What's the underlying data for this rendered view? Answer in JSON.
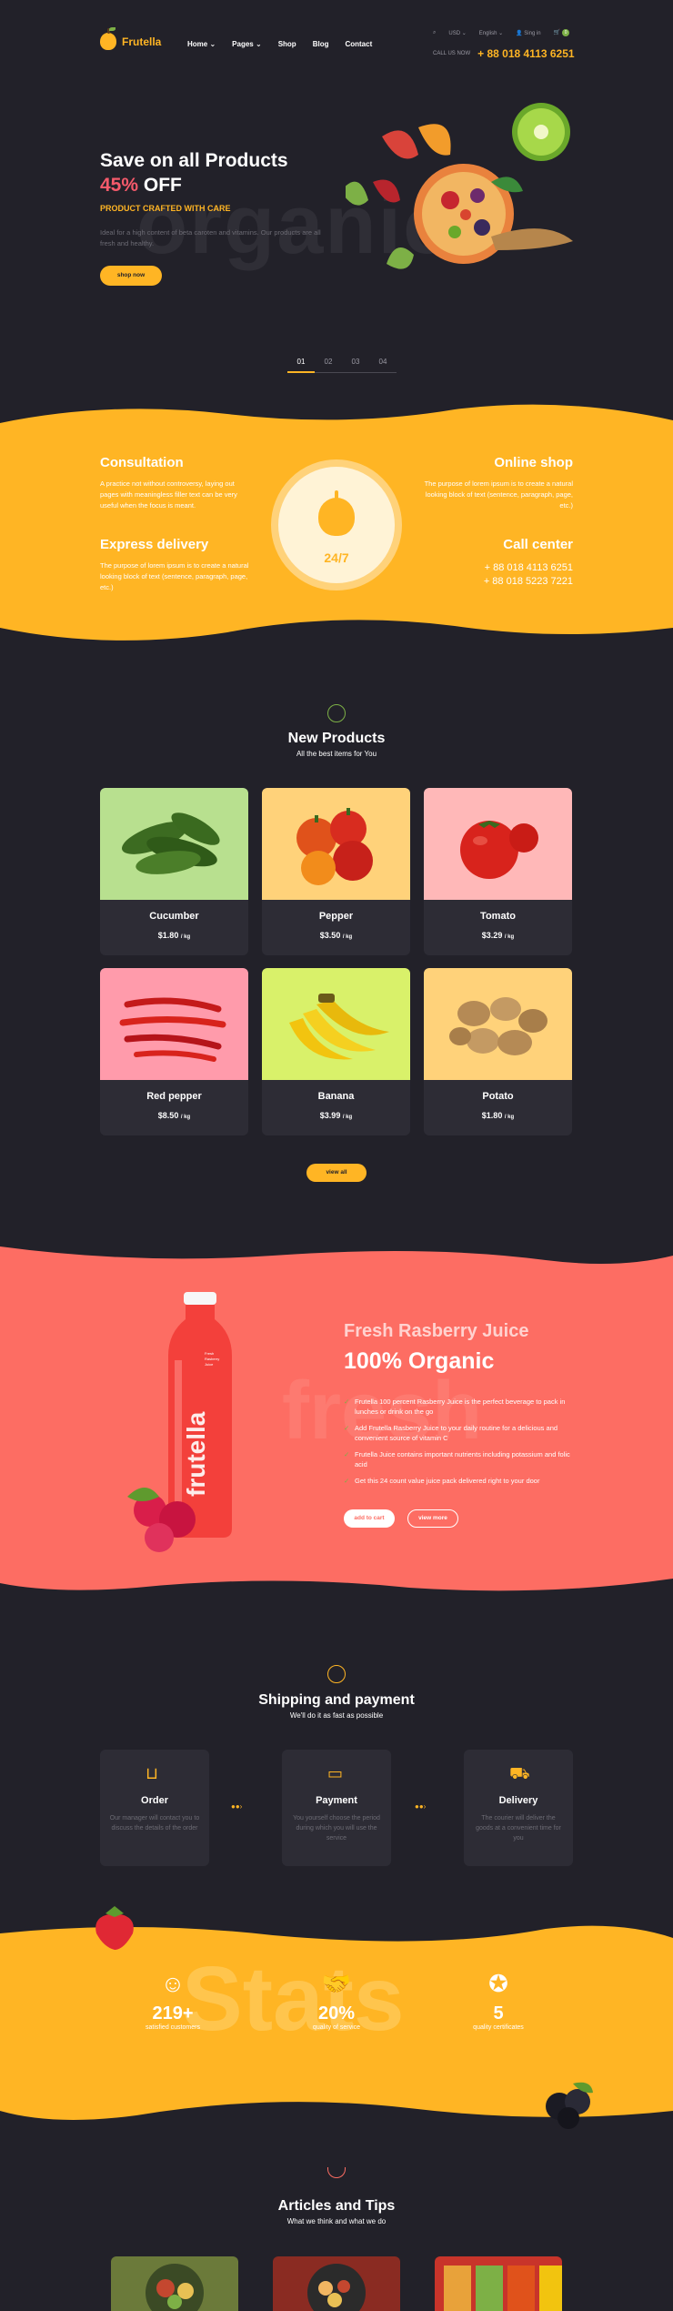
{
  "header": {
    "logo": "Frutella",
    "nav": [
      "Home",
      "Pages",
      "Shop",
      "Blog",
      "Contact"
    ],
    "currency": "USD",
    "language": "English",
    "signin": "Sing in",
    "cart_count": "0",
    "callus_label": "CALL US NOW",
    "phone": "+ 88 018 4113 6251"
  },
  "hero": {
    "title_line1": "Save on all Products",
    "title_pct": "45%",
    "title_off": "OFF",
    "subtitle": "PRODUCT CRAFTED WITH CARE",
    "description": "Ideal for a high content of beta caroten and vitamins. Our products are all fresh and healthy.",
    "bg_word": "organic",
    "button": "shop now",
    "slides": [
      "01",
      "02",
      "03",
      "04"
    ]
  },
  "features": {
    "consultation_title": "Consultation",
    "consultation_text": "A practice not without controversy, laying out pages with meaningless filler text can be very useful when the focus is meant.",
    "express_title": "Express delivery",
    "express_text": "The purpose of lorem ipsum is to create a natural looking block of text (sentence, paragraph, page, etc.)",
    "center_label": "24/7",
    "online_title": "Online shop",
    "online_text": "The purpose of lorem ipsum is to create a natural looking block of text (sentence, paragraph, page, etc.)",
    "call_title": "Call center",
    "call_phone1": "+ 88 018 4113 6251",
    "call_phone2": "+ 88 018 5223 7221"
  },
  "products": {
    "title": "New Products",
    "subtitle": "All the best items for You",
    "items": [
      {
        "name": "Cucumber",
        "price": "$1.80",
        "unit": "/ kg",
        "bg": "#b8e08f"
      },
      {
        "name": "Pepper",
        "price": "$3.50",
        "unit": "/ kg",
        "bg": "#ffd27a"
      },
      {
        "name": "Tomato",
        "price": "$3.29",
        "unit": "/ kg",
        "bg": "#ffb8b8"
      },
      {
        "name": "Red pepper",
        "price": "$8.50",
        "unit": "/ kg",
        "bg": "#ff9bab"
      },
      {
        "name": "Banana",
        "price": "$3.99",
        "unit": "/ kg",
        "bg": "#d9f16a"
      },
      {
        "name": "Potato",
        "price": "$1.80",
        "unit": "/ kg",
        "bg": "#ffd27a"
      }
    ],
    "button": "view all"
  },
  "juice": {
    "title": "Fresh Rasberry Juice",
    "headline": "100% Organic",
    "bg_word": "fresh",
    "bottle_label": "frutella",
    "bottle_small": "Fresh Rasberry Juice",
    "points": [
      "Frutella 100 percent Rasberry Juice is the perfect beverage to pack in lunches or drink on the go",
      "Add Frutella Rasberry Juice to your daily routine for a delicious and convenient source of vitamin C",
      "Frutella Juice contains important nutrients including potassium and folic acid",
      "Get this 24 count value juice pack delivered right to your door"
    ],
    "btn_cart": "add to cart",
    "btn_more": "view more"
  },
  "shipping": {
    "title": "Shipping and payment",
    "subtitle": "We'll do it as fast as possible",
    "steps": [
      {
        "title": "Order",
        "text": "Our manager will contact you to discuss the details of the order"
      },
      {
        "title": "Payment",
        "text": "You yourself choose the period during which you will use the service"
      },
      {
        "title": "Delivery",
        "text": "The courier will deliver the goods at a convenient time for you"
      }
    ]
  },
  "stats": {
    "bg_word": "Stats",
    "items": [
      {
        "value": "219+",
        "label": "satisfied customers"
      },
      {
        "value": "20%",
        "label": "quality of service"
      },
      {
        "value": "5",
        "label": "quality certificates"
      }
    ]
  },
  "articles": {
    "title": "Articles and Tips",
    "subtitle": "What we think and what we do"
  }
}
